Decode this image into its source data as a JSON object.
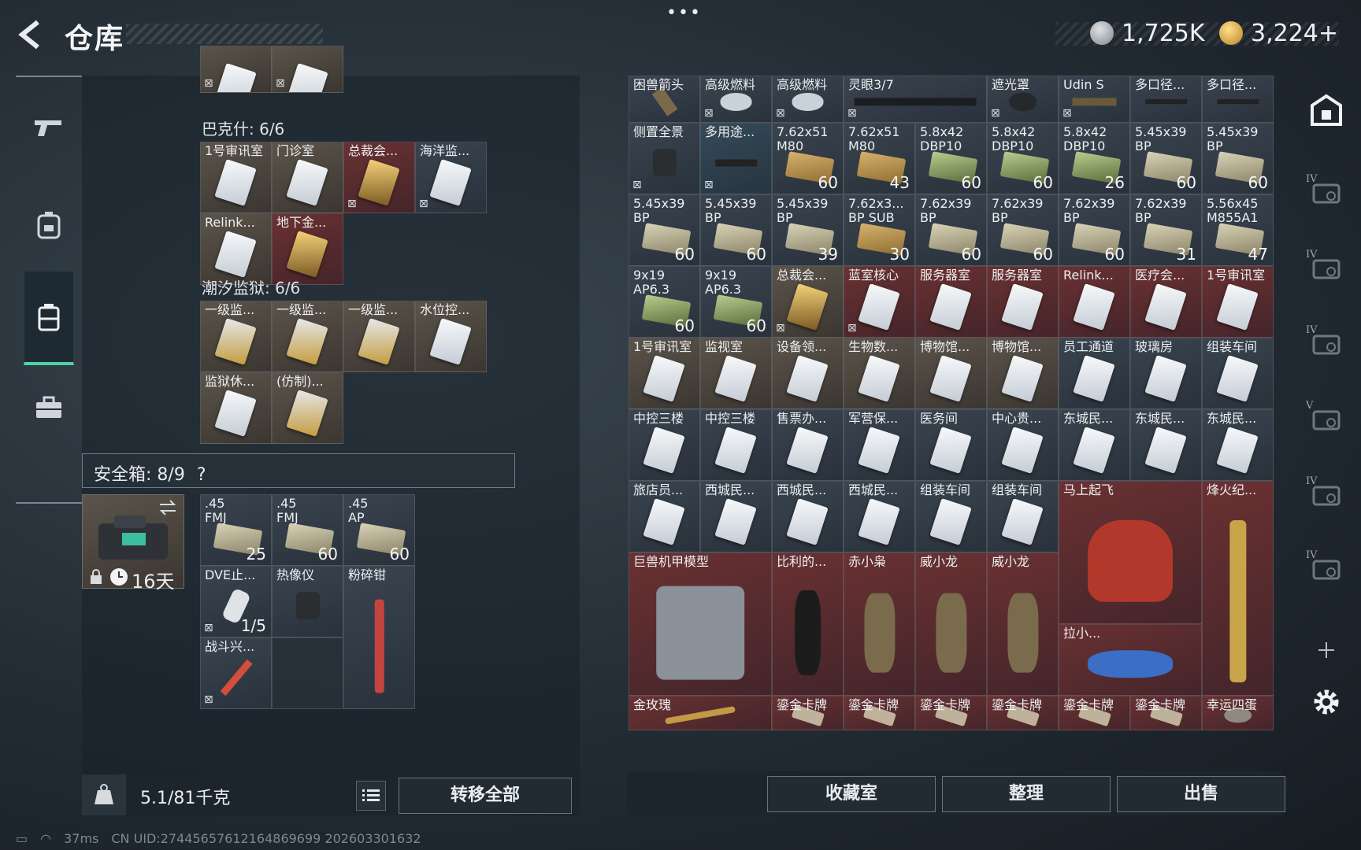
{
  "header": {
    "title": "仓库",
    "dots": "•••",
    "silver": "1,725K",
    "gold": "3,224+"
  },
  "rail_left": [
    {
      "name": "weapon"
    },
    {
      "name": "backpack"
    },
    {
      "name": "storage"
    },
    {
      "name": "briefcase"
    }
  ],
  "left": {
    "top_row": [
      {
        "lock": true
      },
      {
        "lock": true
      }
    ],
    "section1": "巴克什: 6/6",
    "section1_items": [
      {
        "name": "1号审讯室",
        "c": "tan",
        "card": "white"
      },
      {
        "name": "门诊室",
        "c": "tan",
        "card": "white"
      },
      {
        "name": "总裁会...",
        "c": "red",
        "card": "gold",
        "lock": true
      },
      {
        "name": "海洋监...",
        "c": "gray",
        "card": "white",
        "lock": true
      },
      {
        "name": "Relink...",
        "c": "tan",
        "card": "white"
      },
      {
        "name": "地下金...",
        "c": "red",
        "card": "gold"
      }
    ],
    "section2": "潮汐监狱: 6/6",
    "section2_items": [
      {
        "name": "一级监...",
        "c": "tan",
        "card": "goldsm"
      },
      {
        "name": "一级监...",
        "c": "tan",
        "card": "goldsm"
      },
      {
        "name": "一级监...",
        "c": "tan",
        "card": "goldsm"
      },
      {
        "name": "水位控...",
        "c": "tan",
        "card": "white"
      },
      {
        "name": "监狱休...",
        "c": "tan",
        "card": "white"
      },
      {
        "name": "(仿制)...",
        "c": "tan",
        "card": "goldsm"
      }
    ],
    "safe_label": "安全箱: 8/9",
    "safe_help": "?",
    "safe_timer": "16天",
    "safe_items": [
      {
        "name": ".45",
        "name2": "FMJ",
        "qty": "25",
        "c": "gray",
        "k": "ammo"
      },
      {
        "name": ".45",
        "name2": "FMJ",
        "qty": "60",
        "c": "gray",
        "k": "ammo"
      },
      {
        "name": ".45",
        "name2": "AP",
        "qty": "60",
        "c": "gray",
        "k": "ammo"
      },
      {
        "name": "DVE止...",
        "qty": "1/5",
        "c": "gray",
        "k": "tube",
        "lock": true
      },
      {
        "name": "热像仪",
        "c": "gray",
        "k": "scope"
      },
      {
        "name": "粉碎钳",
        "c": "gray",
        "k": "plier"
      },
      {
        "name": "战斗兴...",
        "c": "gray",
        "k": "syringe",
        "lock": true
      }
    ],
    "weight": "5.1/81千克",
    "transfer_all": "转移全部"
  },
  "right": {
    "rows": [
      [
        {
          "name": "困兽箭头",
          "c": "gray",
          "k": "arrow"
        },
        {
          "name": "高级燃料",
          "c": "gray",
          "k": "can",
          "lock": true
        },
        {
          "name": "高级燃料",
          "c": "gray",
          "k": "can",
          "lock": true
        },
        {
          "name": "灵眼3/7",
          "c": "gray",
          "k": "longscope",
          "lock": true,
          "span": 2
        },
        {
          "name": "遮光罩",
          "c": "gray",
          "k": "hood",
          "lock": true
        },
        {
          "name": "Udin S",
          "c": "gray",
          "k": "sight",
          "lock": true
        },
        {
          "name": "多口径...",
          "c": "gray",
          "k": "barrel"
        },
        {
          "name": "多口径...",
          "c": "gray",
          "k": "barrel"
        }
      ],
      [
        {
          "name": "侧置全景",
          "c": "gray",
          "k": "scope",
          "lock": true
        },
        {
          "name": "多用途...",
          "c": "blue",
          "k": "barrel",
          "lock": true
        },
        {
          "name": "7.62x51",
          "name2": "M80",
          "qty": "60",
          "c": "gray",
          "k": "box"
        },
        {
          "name": "7.62x51",
          "name2": "M80",
          "qty": "43",
          "c": "gray",
          "k": "box"
        },
        {
          "name": "5.8x42",
          "name2": "DBP10",
          "qty": "60",
          "c": "gray",
          "k": "green"
        },
        {
          "name": "5.8x42",
          "name2": "DBP10",
          "qty": "60",
          "c": "gray",
          "k": "green"
        },
        {
          "name": "5.8x42",
          "name2": "DBP10",
          "qty": "26",
          "c": "gray",
          "k": "green"
        },
        {
          "name": "5.45x39",
          "name2": "BP",
          "qty": "60",
          "c": "gray",
          "k": "ammo"
        },
        {
          "name": "5.45x39",
          "name2": "BP",
          "qty": "60",
          "c": "gray",
          "k": "ammo"
        }
      ],
      [
        {
          "name": "5.45x39",
          "name2": "BP",
          "qty": "60",
          "c": "gray",
          "k": "ammo"
        },
        {
          "name": "5.45x39",
          "name2": "BP",
          "qty": "60",
          "c": "gray",
          "k": "ammo"
        },
        {
          "name": "5.45x39",
          "name2": "BP",
          "qty": "39",
          "c": "gray",
          "k": "ammo"
        },
        {
          "name": "7.62x3...",
          "name2": "BP SUB",
          "qty": "30",
          "c": "gray",
          "k": "box"
        },
        {
          "name": "7.62x39",
          "name2": "BP",
          "qty": "60",
          "c": "gray",
          "k": "ammo"
        },
        {
          "name": "7.62x39",
          "name2": "BP",
          "qty": "60",
          "c": "gray",
          "k": "ammo"
        },
        {
          "name": "7.62x39",
          "name2": "BP",
          "qty": "60",
          "c": "gray",
          "k": "ammo"
        },
        {
          "name": "7.62x39",
          "name2": "BP",
          "qty": "31",
          "c": "gray",
          "k": "ammo"
        },
        {
          "name": "5.56x45",
          "name2": "M855A1",
          "qty": "47",
          "c": "gray",
          "k": "ammo"
        }
      ],
      [
        {
          "name": "9x19",
          "name2": "AP6.3",
          "qty": "60",
          "c": "gray",
          "k": "green"
        },
        {
          "name": "9x19",
          "name2": "AP6.3",
          "qty": "60",
          "c": "gray",
          "k": "green"
        },
        {
          "name": "总裁会...",
          "c": "tan",
          "k": "gold",
          "lock": true
        },
        {
          "name": "蓝室核心",
          "c": "red",
          "k": "card",
          "lock": true
        },
        {
          "name": "服务器室",
          "c": "red",
          "k": "card"
        },
        {
          "name": "服务器室",
          "c": "red",
          "k": "card"
        },
        {
          "name": "Relink...",
          "c": "red",
          "k": "card"
        },
        {
          "name": "医疗会...",
          "c": "red",
          "k": "card"
        },
        {
          "name": "1号审讯室",
          "c": "red",
          "k": "card"
        }
      ],
      [
        {
          "name": "1号审讯室",
          "c": "tan",
          "k": "card"
        },
        {
          "name": "监视室",
          "c": "tan",
          "k": "card"
        },
        {
          "name": "设备领...",
          "c": "tan",
          "k": "card"
        },
        {
          "name": "生物数...",
          "c": "tan",
          "k": "card"
        },
        {
          "name": "博物馆...",
          "c": "tan",
          "k": "card"
        },
        {
          "name": "博物馆...",
          "c": "tan",
          "k": "card"
        },
        {
          "name": "员工通道",
          "c": "gray",
          "k": "card"
        },
        {
          "name": "玻璃房",
          "c": "gray",
          "k": "card"
        },
        {
          "name": "组装车间",
          "c": "gray",
          "k": "card"
        }
      ],
      [
        {
          "name": "中控三楼",
          "c": "gray",
          "k": "card"
        },
        {
          "name": "中控三楼",
          "c": "gray",
          "k": "card"
        },
        {
          "name": "售票办...",
          "c": "gray",
          "k": "card"
        },
        {
          "name": "军营保...",
          "c": "gray",
          "k": "card"
        },
        {
          "name": "医务间",
          "c": "gray",
          "k": "card"
        },
        {
          "name": "中心贵...",
          "c": "gray",
          "k": "card"
        },
        {
          "name": "东城民...",
          "c": "gray",
          "k": "card"
        },
        {
          "name": "东城民...",
          "c": "gray",
          "k": "card"
        },
        {
          "name": "东城民...",
          "c": "gray",
          "k": "card"
        }
      ],
      [
        {
          "name": "旅店员...",
          "c": "gray",
          "k": "card"
        },
        {
          "name": "西城民...",
          "c": "gray",
          "k": "card"
        },
        {
          "name": "西城民...",
          "c": "gray",
          "k": "card"
        },
        {
          "name": "西城民...",
          "c": "gray",
          "k": "card"
        },
        {
          "name": "组装车间",
          "c": "gray",
          "k": "card"
        },
        {
          "name": "组装车间",
          "c": "gray",
          "k": "card"
        }
      ]
    ],
    "big_items": [
      {
        "name": "马上起飞",
        "c": "red",
        "k": "horse"
      },
      {
        "name": "烽火纪...",
        "c": "red",
        "k": "trophy"
      },
      {
        "name": "巨兽机甲模型",
        "c": "red",
        "k": "mech"
      },
      {
        "name": "比利的...",
        "c": "red",
        "k": "doll"
      },
      {
        "name": "赤小枭",
        "c": "red",
        "k": "figure"
      },
      {
        "name": "威小龙",
        "c": "red",
        "k": "figure"
      },
      {
        "name": "威小龙",
        "c": "red",
        "k": "figure"
      },
      {
        "name": "拉小...",
        "c": "red",
        "k": "toy"
      },
      {
        "name": "金玫瑰",
        "c": "red",
        "k": "rose"
      },
      {
        "name": "鎏金卡牌",
        "c": "red",
        "k": "cardgold"
      },
      {
        "name": "鎏金卡牌",
        "c": "red",
        "k": "cardgold"
      },
      {
        "name": "鎏金卡牌",
        "c": "red",
        "k": "cardgold"
      },
      {
        "name": "鎏金卡牌",
        "c": "red",
        "k": "cardgold"
      },
      {
        "name": "鎏金卡牌",
        "c": "red",
        "k": "cardgold"
      },
      {
        "name": "鎏金卡牌",
        "c": "red",
        "k": "cardgold"
      },
      {
        "name": "幸运四蛋",
        "c": "red",
        "k": "egg"
      }
    ],
    "buttons": {
      "collection": "收藏室",
      "sort": "整理",
      "sell": "出售"
    }
  },
  "rail_right": [
    {
      "name": "home",
      "lv": ""
    },
    {
      "name": "slot-iv-1",
      "lv": "IV"
    },
    {
      "name": "slot-iv-2",
      "lv": "IV"
    },
    {
      "name": "slot-iv-3",
      "lv": "IV"
    },
    {
      "name": "slot-v",
      "lv": "V"
    },
    {
      "name": "slot-iv-4",
      "lv": "IV"
    },
    {
      "name": "slot-iv-5",
      "lv": "IV"
    },
    {
      "name": "add",
      "lv": ""
    },
    {
      "name": "settings",
      "lv": ""
    }
  ],
  "status": {
    "ping": "37ms",
    "uid": "CN UID:27445657612164869699 202603301632"
  }
}
